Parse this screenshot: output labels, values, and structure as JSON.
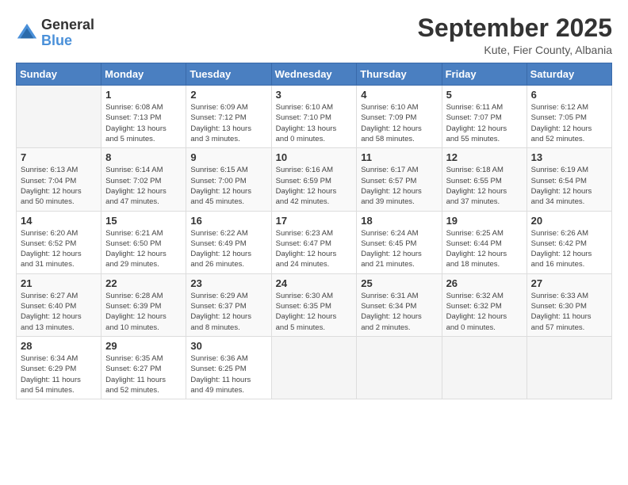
{
  "logo": {
    "general": "General",
    "blue": "Blue"
  },
  "title": "September 2025",
  "subtitle": "Kute, Fier County, Albania",
  "days_header": [
    "Sunday",
    "Monday",
    "Tuesday",
    "Wednesday",
    "Thursday",
    "Friday",
    "Saturday"
  ],
  "weeks": [
    [
      {
        "day": "",
        "info": ""
      },
      {
        "day": "1",
        "info": "Sunrise: 6:08 AM\nSunset: 7:13 PM\nDaylight: 13 hours\nand 5 minutes."
      },
      {
        "day": "2",
        "info": "Sunrise: 6:09 AM\nSunset: 7:12 PM\nDaylight: 13 hours\nand 3 minutes."
      },
      {
        "day": "3",
        "info": "Sunrise: 6:10 AM\nSunset: 7:10 PM\nDaylight: 13 hours\nand 0 minutes."
      },
      {
        "day": "4",
        "info": "Sunrise: 6:10 AM\nSunset: 7:09 PM\nDaylight: 12 hours\nand 58 minutes."
      },
      {
        "day": "5",
        "info": "Sunrise: 6:11 AM\nSunset: 7:07 PM\nDaylight: 12 hours\nand 55 minutes."
      },
      {
        "day": "6",
        "info": "Sunrise: 6:12 AM\nSunset: 7:05 PM\nDaylight: 12 hours\nand 52 minutes."
      }
    ],
    [
      {
        "day": "7",
        "info": "Sunrise: 6:13 AM\nSunset: 7:04 PM\nDaylight: 12 hours\nand 50 minutes."
      },
      {
        "day": "8",
        "info": "Sunrise: 6:14 AM\nSunset: 7:02 PM\nDaylight: 12 hours\nand 47 minutes."
      },
      {
        "day": "9",
        "info": "Sunrise: 6:15 AM\nSunset: 7:00 PM\nDaylight: 12 hours\nand 45 minutes."
      },
      {
        "day": "10",
        "info": "Sunrise: 6:16 AM\nSunset: 6:59 PM\nDaylight: 12 hours\nand 42 minutes."
      },
      {
        "day": "11",
        "info": "Sunrise: 6:17 AM\nSunset: 6:57 PM\nDaylight: 12 hours\nand 39 minutes."
      },
      {
        "day": "12",
        "info": "Sunrise: 6:18 AM\nSunset: 6:55 PM\nDaylight: 12 hours\nand 37 minutes."
      },
      {
        "day": "13",
        "info": "Sunrise: 6:19 AM\nSunset: 6:54 PM\nDaylight: 12 hours\nand 34 minutes."
      }
    ],
    [
      {
        "day": "14",
        "info": "Sunrise: 6:20 AM\nSunset: 6:52 PM\nDaylight: 12 hours\nand 31 minutes."
      },
      {
        "day": "15",
        "info": "Sunrise: 6:21 AM\nSunset: 6:50 PM\nDaylight: 12 hours\nand 29 minutes."
      },
      {
        "day": "16",
        "info": "Sunrise: 6:22 AM\nSunset: 6:49 PM\nDaylight: 12 hours\nand 26 minutes."
      },
      {
        "day": "17",
        "info": "Sunrise: 6:23 AM\nSunset: 6:47 PM\nDaylight: 12 hours\nand 24 minutes."
      },
      {
        "day": "18",
        "info": "Sunrise: 6:24 AM\nSunset: 6:45 PM\nDaylight: 12 hours\nand 21 minutes."
      },
      {
        "day": "19",
        "info": "Sunrise: 6:25 AM\nSunset: 6:44 PM\nDaylight: 12 hours\nand 18 minutes."
      },
      {
        "day": "20",
        "info": "Sunrise: 6:26 AM\nSunset: 6:42 PM\nDaylight: 12 hours\nand 16 minutes."
      }
    ],
    [
      {
        "day": "21",
        "info": "Sunrise: 6:27 AM\nSunset: 6:40 PM\nDaylight: 12 hours\nand 13 minutes."
      },
      {
        "day": "22",
        "info": "Sunrise: 6:28 AM\nSunset: 6:39 PM\nDaylight: 12 hours\nand 10 minutes."
      },
      {
        "day": "23",
        "info": "Sunrise: 6:29 AM\nSunset: 6:37 PM\nDaylight: 12 hours\nand 8 minutes."
      },
      {
        "day": "24",
        "info": "Sunrise: 6:30 AM\nSunset: 6:35 PM\nDaylight: 12 hours\nand 5 minutes."
      },
      {
        "day": "25",
        "info": "Sunrise: 6:31 AM\nSunset: 6:34 PM\nDaylight: 12 hours\nand 2 minutes."
      },
      {
        "day": "26",
        "info": "Sunrise: 6:32 AM\nSunset: 6:32 PM\nDaylight: 12 hours\nand 0 minutes."
      },
      {
        "day": "27",
        "info": "Sunrise: 6:33 AM\nSunset: 6:30 PM\nDaylight: 11 hours\nand 57 minutes."
      }
    ],
    [
      {
        "day": "28",
        "info": "Sunrise: 6:34 AM\nSunset: 6:29 PM\nDaylight: 11 hours\nand 54 minutes."
      },
      {
        "day": "29",
        "info": "Sunrise: 6:35 AM\nSunset: 6:27 PM\nDaylight: 11 hours\nand 52 minutes."
      },
      {
        "day": "30",
        "info": "Sunrise: 6:36 AM\nSunset: 6:25 PM\nDaylight: 11 hours\nand 49 minutes."
      },
      {
        "day": "",
        "info": ""
      },
      {
        "day": "",
        "info": ""
      },
      {
        "day": "",
        "info": ""
      },
      {
        "day": "",
        "info": ""
      }
    ]
  ]
}
